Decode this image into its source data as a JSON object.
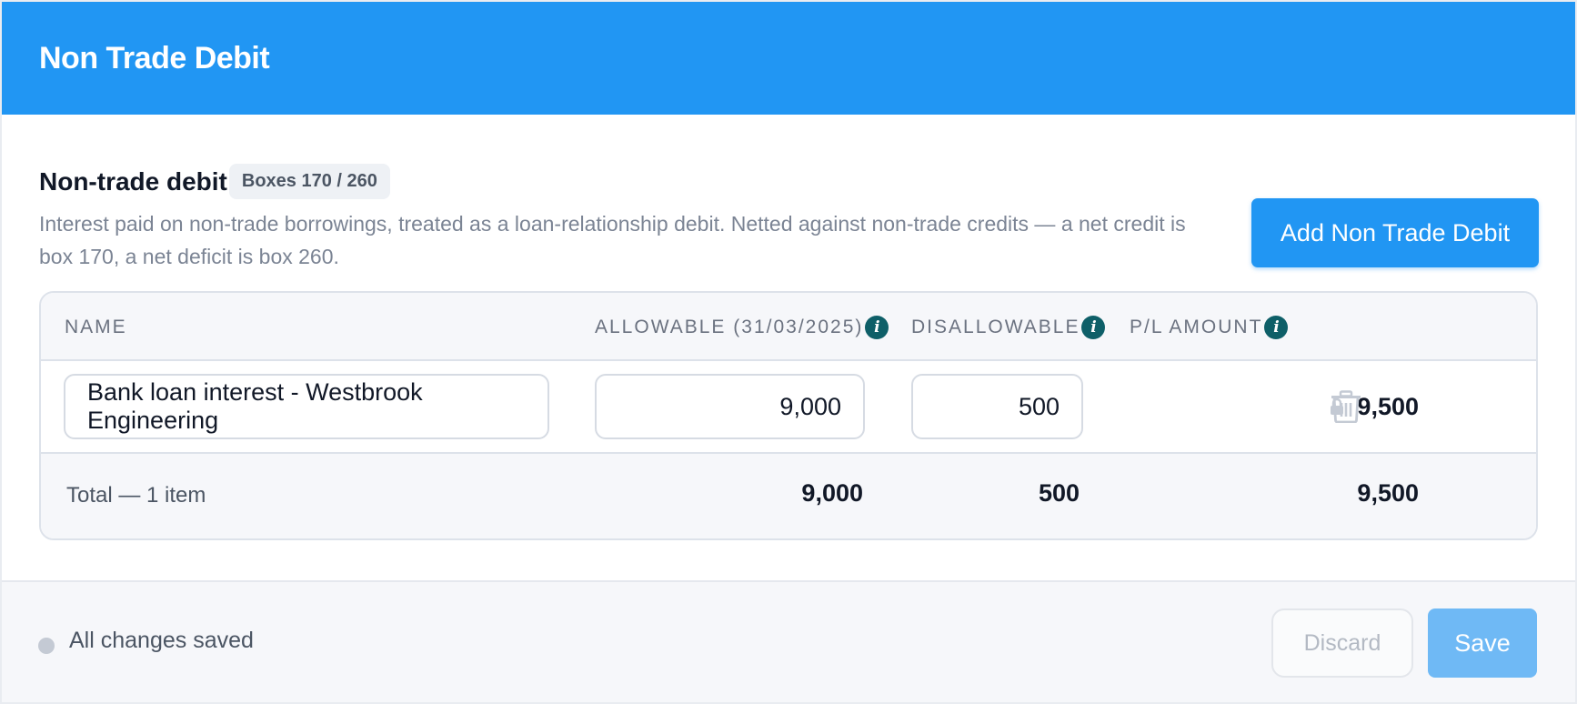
{
  "header": {
    "title": "Non Trade Debit"
  },
  "section": {
    "title": "Non-trade debit",
    "badge": "Boxes 170 / 260",
    "description": "Interest paid on non-trade borrowings, treated as a loan-relationship debit. Netted against non-trade credits — a net credit is box 170, a net deficit is box 260.",
    "add_button_label": "Add Non Trade Debit"
  },
  "table": {
    "columns": {
      "name": "NAME",
      "allowable": "ALLOWABLE (31/03/2025)",
      "disallowable": "DISALLOWABLE",
      "pl_amount": "P/L AMOUNT"
    },
    "rows": [
      {
        "name": "Bank loan interest - Westbrook Engineering",
        "allowable": "9,000",
        "disallowable": "500",
        "pl_amount": "9,500",
        "pl_icon": "lock-icon",
        "action_icon": "trash-icon"
      }
    ],
    "total": {
      "label": "Total — 1 item",
      "allowable": "9,000",
      "disallowable": "500",
      "pl_amount": "9,500"
    }
  },
  "footer": {
    "status_text": "All changes saved",
    "discard_label": "Discard",
    "save_label": "Save"
  },
  "colors": {
    "header": "#2196f3",
    "primary_button": "#2196f3",
    "info_icon": "#0e5f68",
    "save_disabled": "#6fb9f5"
  }
}
